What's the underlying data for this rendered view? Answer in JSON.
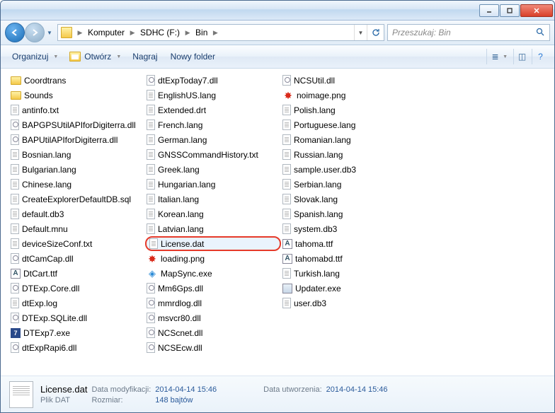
{
  "breadcrumb": {
    "parts": [
      "Komputer",
      "SDHC (F:)",
      "Bin"
    ]
  },
  "search": {
    "placeholder": "Przeszukaj: Bin"
  },
  "toolbar": {
    "organize": "Organizuj",
    "open": "Otwórz",
    "burn": "Nagraj",
    "newfolder": "Nowy folder"
  },
  "columns": [
    [
      {
        "n": "Coordtrans",
        "t": "folder"
      },
      {
        "n": "Sounds",
        "t": "folder"
      },
      {
        "n": "antinfo.txt",
        "t": "file"
      },
      {
        "n": "BAPGPSUtilAPIforDigiterra.dll",
        "t": "dll"
      },
      {
        "n": "BAPUtilAPIforDigiterra.dll",
        "t": "dll"
      },
      {
        "n": "Bosnian.lang",
        "t": "file"
      },
      {
        "n": "Bulgarian.lang",
        "t": "file"
      },
      {
        "n": "Chinese.lang",
        "t": "file"
      },
      {
        "n": "CreateExplorerDefaultDB.sql",
        "t": "file"
      },
      {
        "n": "default.db3",
        "t": "file"
      },
      {
        "n": "Default.mnu",
        "t": "file"
      },
      {
        "n": "deviceSizeConf.txt",
        "t": "file"
      },
      {
        "n": "dtCamCap.dll",
        "t": "dll"
      },
      {
        "n": "DtCart.ttf",
        "t": "ttf"
      },
      {
        "n": "DTExp.Core.dll",
        "t": "dll"
      },
      {
        "n": "dtExp.log",
        "t": "file"
      },
      {
        "n": "DTExp.SQLite.dll",
        "t": "dll"
      },
      {
        "n": "DTExp7.exe",
        "t": "exe"
      },
      {
        "n": "dtExpRapi6.dll",
        "t": "dll"
      }
    ],
    [
      {
        "n": "dtExpToday7.dll",
        "t": "dll"
      },
      {
        "n": "EnglishUS.lang",
        "t": "file"
      },
      {
        "n": "Extended.drt",
        "t": "file"
      },
      {
        "n": "French.lang",
        "t": "file"
      },
      {
        "n": "German.lang",
        "t": "file"
      },
      {
        "n": "GNSSCommandHistory.txt",
        "t": "file"
      },
      {
        "n": "Greek.lang",
        "t": "file"
      },
      {
        "n": "Hungarian.lang",
        "t": "file"
      },
      {
        "n": "Italian.lang",
        "t": "file"
      },
      {
        "n": "Korean.lang",
        "t": "file"
      },
      {
        "n": "Latvian.lang",
        "t": "file"
      },
      {
        "n": "License.dat",
        "t": "file",
        "hl": true
      },
      {
        "n": "loading.png",
        "t": "png"
      },
      {
        "n": "MapSync.exe",
        "t": "cube"
      },
      {
        "n": "Mm6Gps.dll",
        "t": "dll"
      },
      {
        "n": "mmrdlog.dll",
        "t": "dll"
      },
      {
        "n": "msvcr80.dll",
        "t": "dll"
      },
      {
        "n": "NCScnet.dll",
        "t": "dll"
      },
      {
        "n": "NCSEcw.dll",
        "t": "dll"
      }
    ],
    [
      {
        "n": "NCSUtil.dll",
        "t": "dll"
      },
      {
        "n": "noimage.png",
        "t": "png"
      },
      {
        "n": "Polish.lang",
        "t": "file"
      },
      {
        "n": "Portuguese.lang",
        "t": "file"
      },
      {
        "n": "Romanian.lang",
        "t": "file"
      },
      {
        "n": "Russian.lang",
        "t": "file"
      },
      {
        "n": "sample.user.db3",
        "t": "file"
      },
      {
        "n": "Serbian.lang",
        "t": "file"
      },
      {
        "n": "Slovak.lang",
        "t": "file"
      },
      {
        "n": "Spanish.lang",
        "t": "file"
      },
      {
        "n": "system.db3",
        "t": "file"
      },
      {
        "n": "tahoma.ttf",
        "t": "ttf"
      },
      {
        "n": "tahomabd.ttf",
        "t": "ttf"
      },
      {
        "n": "Turkish.lang",
        "t": "file"
      },
      {
        "n": "Updater.exe",
        "t": "exe2"
      },
      {
        "n": "user.db3",
        "t": "file"
      }
    ]
  ],
  "details": {
    "filename": "License.dat",
    "type": "Plik DAT",
    "mod_label": "Data modyfikacji:",
    "mod_val": "2014-04-14 15:46",
    "size_label": "Rozmiar:",
    "size_val": "148 bajtów",
    "created_label": "Data utworzenia:",
    "created_val": "2014-04-14 15:46"
  }
}
